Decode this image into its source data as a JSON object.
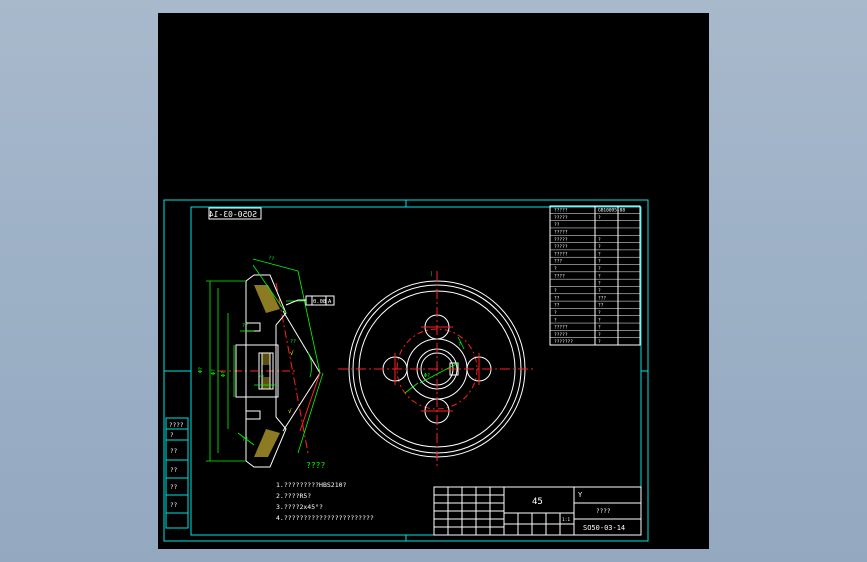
{
  "colors": {
    "background": "#000000",
    "frame": "#00e5e5",
    "geometry": "#ffffff",
    "dimension": "#00ff00",
    "centerline": "#ff2020",
    "text": "#ffffff",
    "hatch": "#ffe040"
  },
  "drawing": {
    "mirrored_label": "SO50-03-14",
    "notes_title": "????",
    "notes": [
      "1.?????????HBS210?",
      "2.????R5?",
      "3.????2x45°?",
      "4.???????????????????????"
    ],
    "datum_frame": "0.08"
  },
  "left_strip": {
    "top_label": "????",
    "cells": [
      "?",
      "??",
      "??",
      "??",
      "??"
    ]
  },
  "param_table": {
    "rows": [
      [
        "?????",
        "GB10095-88"
      ],
      [
        "?????",
        "?"
      ],
      [
        "??",
        ""
      ],
      [
        "?????",
        ""
      ],
      [
        "?????",
        "?"
      ],
      [
        "?????",
        "?"
      ],
      [
        "?????",
        "?"
      ],
      [
        "???",
        "?"
      ],
      [
        "?",
        "?"
      ],
      [
        "????",
        "?"
      ],
      [
        "",
        "?"
      ],
      [
        "?",
        "?"
      ],
      [
        "??",
        "???"
      ],
      [
        "??",
        "??"
      ],
      [
        "?",
        "?"
      ],
      [
        "?",
        "?"
      ],
      [
        "?????",
        "?"
      ],
      [
        "?????",
        "?"
      ],
      [
        "???????",
        "?"
      ]
    ]
  },
  "title_block": {
    "material": "45",
    "drawing_number": "SO50-03-14",
    "part_name": "????",
    "company": "Y",
    "scale_label": "1:1"
  }
}
